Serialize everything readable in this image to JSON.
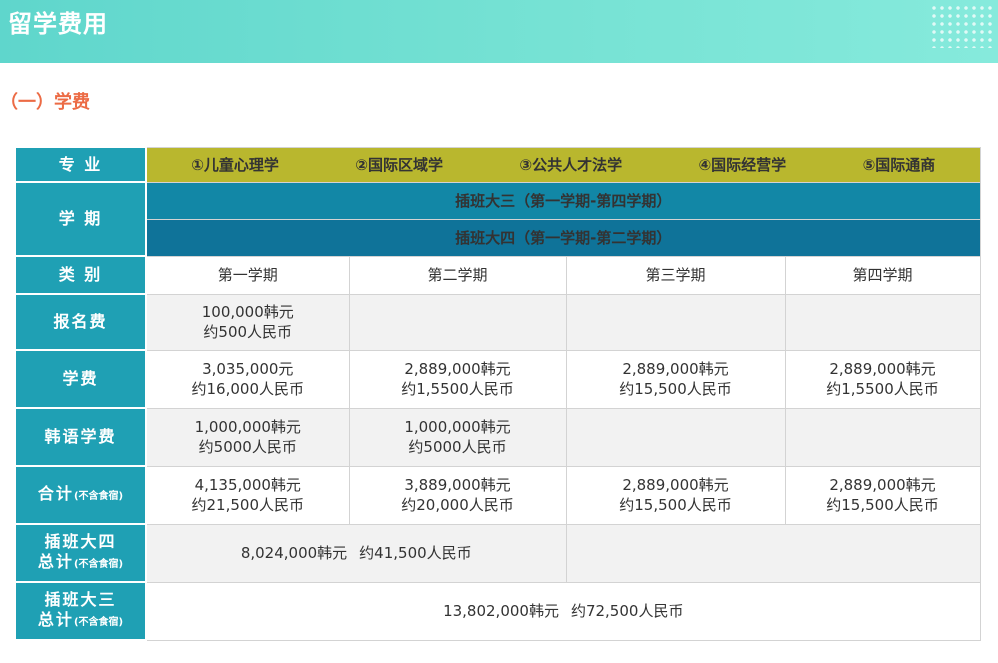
{
  "banner": {
    "title": "留学费用"
  },
  "section": {
    "title": "（一）学费"
  },
  "table": {
    "major_label": "专  业",
    "majors": [
      "①儿童心理学",
      "②国际区域学",
      "③公共人才法学",
      "④国际经营学",
      "⑤国际通商"
    ],
    "semester_label": "学  期",
    "semester_band1": "插班大三（第一学期-第四学期）",
    "semester_band2": "插班大四（第一学期-第二学期）",
    "category_label": "类  别",
    "terms": [
      "第一学期",
      "第二学期",
      "第三学期",
      "第四学期"
    ],
    "rows": {
      "registration": {
        "label": "报名费",
        "t1": [
          "100,000韩元",
          "约500人民币"
        ]
      },
      "tuition": {
        "label": "学费",
        "t1": [
          "3,035,000元",
          "约16,000人民币"
        ],
        "t2": [
          "2,889,000韩元",
          "约1,5500人民币"
        ],
        "t3": [
          "2,889,000韩元",
          "约15,500人民币"
        ],
        "t4": [
          "2,889,000韩元",
          "约1,5500人民币"
        ]
      },
      "korean": {
        "label": "韩语学费",
        "t1": [
          "1,000,000韩元",
          "约5000人民币"
        ],
        "t2": [
          "1,000,000韩元",
          "约5000人民币"
        ]
      },
      "subtotal": {
        "label": "合计",
        "label_note": "(不含食宿)",
        "t1": [
          "4,135,000韩元",
          "约21,500人民币"
        ],
        "t2": [
          "3,889,000韩元",
          "约20,000人民币"
        ],
        "t3": [
          "2,889,000韩元",
          "约15,500人民币"
        ],
        "t4": [
          "2,889,000韩元",
          "约15,500人民币"
        ]
      },
      "senior_total": {
        "label_line1": "插班大四",
        "label_line2": "总计",
        "label_note": "(不含食宿)",
        "krw": "8,024,000韩元",
        "rmb": "约41,500人民币"
      },
      "junior_total": {
        "label_line1": "插班大三",
        "label_line2": "总计",
        "label_note": "(不含食宿)",
        "krw": "13,802,000韩元",
        "rmb": "约72,500人民币"
      }
    }
  }
}
